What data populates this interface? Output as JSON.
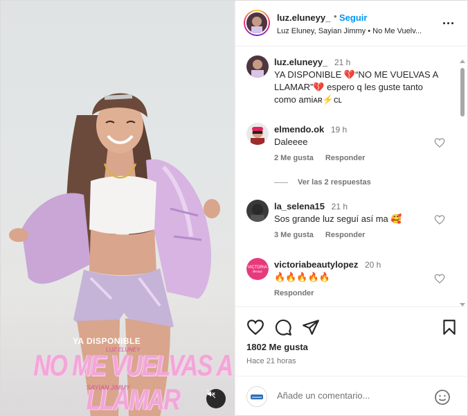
{
  "media": {
    "overlay_ya": "YA DISPONIBLE",
    "overlay_artist": "LUZ ELUNEY",
    "overlay_song": "NO ME VUELVAS A LLAMAR",
    "overlay_feat": "SAYIAN JIMMY",
    "mute_icon": "speaker-muted-icon"
  },
  "header": {
    "username": "luz.eluneyy_",
    "separator": "•",
    "follow_label": "Seguir",
    "audio": "Luz Eluney, Sayian Jimmy • No Me Vuelv..."
  },
  "caption": {
    "username": "luz.eluneyy_",
    "time": "21 h",
    "line1": "YA DISPONIBLE 💔“NO ME VUELVAS A",
    "line2": "LLAMAR”💔 espero q les guste tanto",
    "line3": "como amiᴀʀ⚡ᴄʟ"
  },
  "comments": [
    {
      "username": "elmendo.ok",
      "time": "19 h",
      "text": "Daleeee",
      "likes": "2 Me gusta",
      "reply": "Responder",
      "view_replies": "Ver las 2 respuestas"
    },
    {
      "username": "la_selena15",
      "time": "21 h",
      "text": "Sos grande luz seguí así ma 🥰",
      "likes": "3 Me gusta",
      "reply": "Responder"
    },
    {
      "username": "victoriabeautylopez",
      "time": "20 h",
      "text": "🔥🔥🔥🔥🔥",
      "reply": "Responder"
    }
  ],
  "actions": {
    "likes": "1802 Me gusta",
    "posted": "Hace 21 horas"
  },
  "composer": {
    "placeholder": "Añade un comentario..."
  },
  "colors": {
    "accent": "#0095f6",
    "text": "#262626",
    "muted": "#737373",
    "heart_red": "#e0245e"
  }
}
